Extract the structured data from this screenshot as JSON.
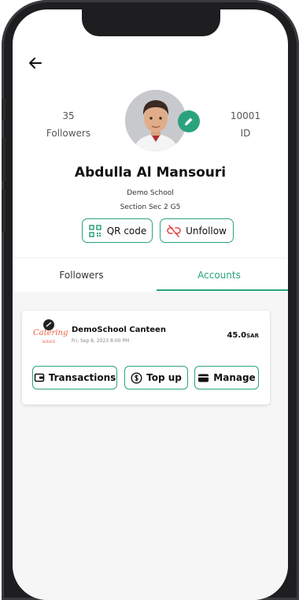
{
  "header": {
    "back_icon": "arrow-left-icon"
  },
  "profile": {
    "followers_count": "35",
    "followers_label": "Followers",
    "id_value": "10001",
    "id_label": "ID",
    "name": "Abdulla Al Mansouri",
    "school": "Demo School",
    "section": "Section  Sec 2 G5"
  },
  "actions": {
    "qr_label": "QR code",
    "unfollow_label": "Unfollow"
  },
  "tabs": [
    {
      "label": "Followers",
      "active": false
    },
    {
      "label": "Accounts",
      "active": true
    }
  ],
  "account": {
    "logo_text": "Catering",
    "logo_subtext": "SERVICE",
    "name": "DemoSchool Canteen",
    "date": "Fri, Sep 8, 2023 8:00 PM",
    "amount": "45.0",
    "currency": "SAR",
    "buttons": {
      "transactions": "Transactions",
      "topup": "Top up",
      "manage": "Manage"
    }
  },
  "colors": {
    "accent": "#2aa37d",
    "logo": "#e8633c"
  }
}
